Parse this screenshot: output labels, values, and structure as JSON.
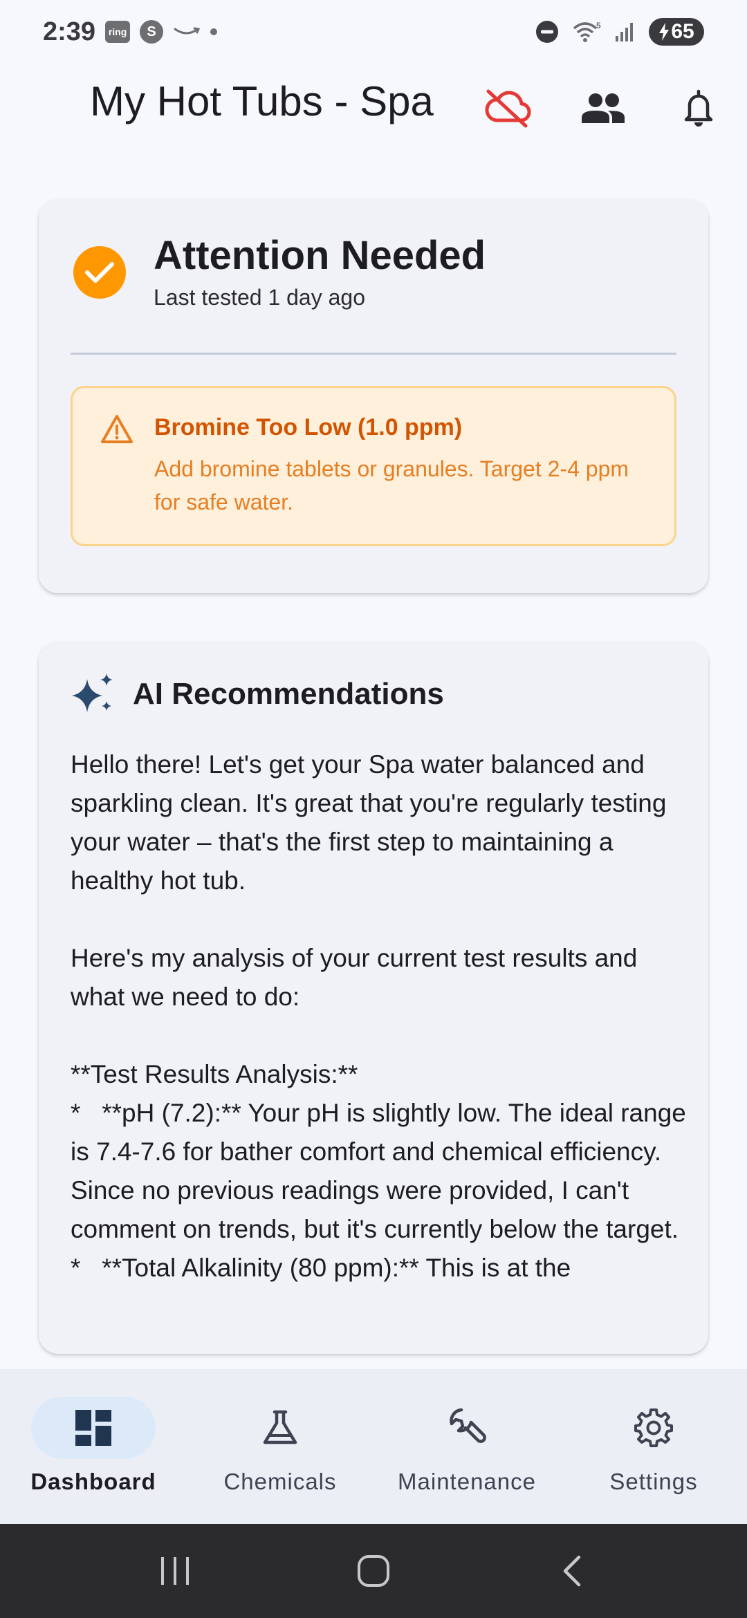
{
  "status_bar": {
    "time": "2:39",
    "notif_ring": "ring",
    "notif_s": "S",
    "battery": "65"
  },
  "app_bar": {
    "title": "My Hot Tubs - Spa",
    "icons": [
      "cloud-off-icon",
      "people-icon",
      "bell-icon"
    ],
    "cloud_off_color": "#e53935"
  },
  "status_card": {
    "title": "Attention Needed",
    "subtitle": "Last tested 1 day ago",
    "status_color": "#ff9800",
    "alert": {
      "title": "Bromine Too Low (1.0 ppm)",
      "body": "Add bromine tablets or granules. Target 2-4 ppm for safe water."
    }
  },
  "ai_card": {
    "title": "AI Recommendations",
    "text": "Hello there! Let's get your Spa water balanced and sparkling clean. It's great that you're regularly testing your water – that's the first step to maintaining a healthy hot tub.\n\nHere's my analysis of your current test results and what we need to do:\n\n**Test Results Analysis:**\n*   **pH (7.2):** Your pH is slightly low. The ideal range is 7.4-7.6 for bather comfort and chemical efficiency. Since no previous readings were provided, I can't comment on trends, but it's currently below the target.\n*   **Total Alkalinity (80 ppm):** This is at the"
  },
  "bottom_nav": {
    "items": [
      {
        "label": "Dashboard",
        "icon": "dashboard-icon",
        "active": true
      },
      {
        "label": "Chemicals",
        "icon": "flask-icon",
        "active": false
      },
      {
        "label": "Maintenance",
        "icon": "wrench-icon",
        "active": false
      },
      {
        "label": "Settings",
        "icon": "gear-icon",
        "active": false
      }
    ]
  }
}
